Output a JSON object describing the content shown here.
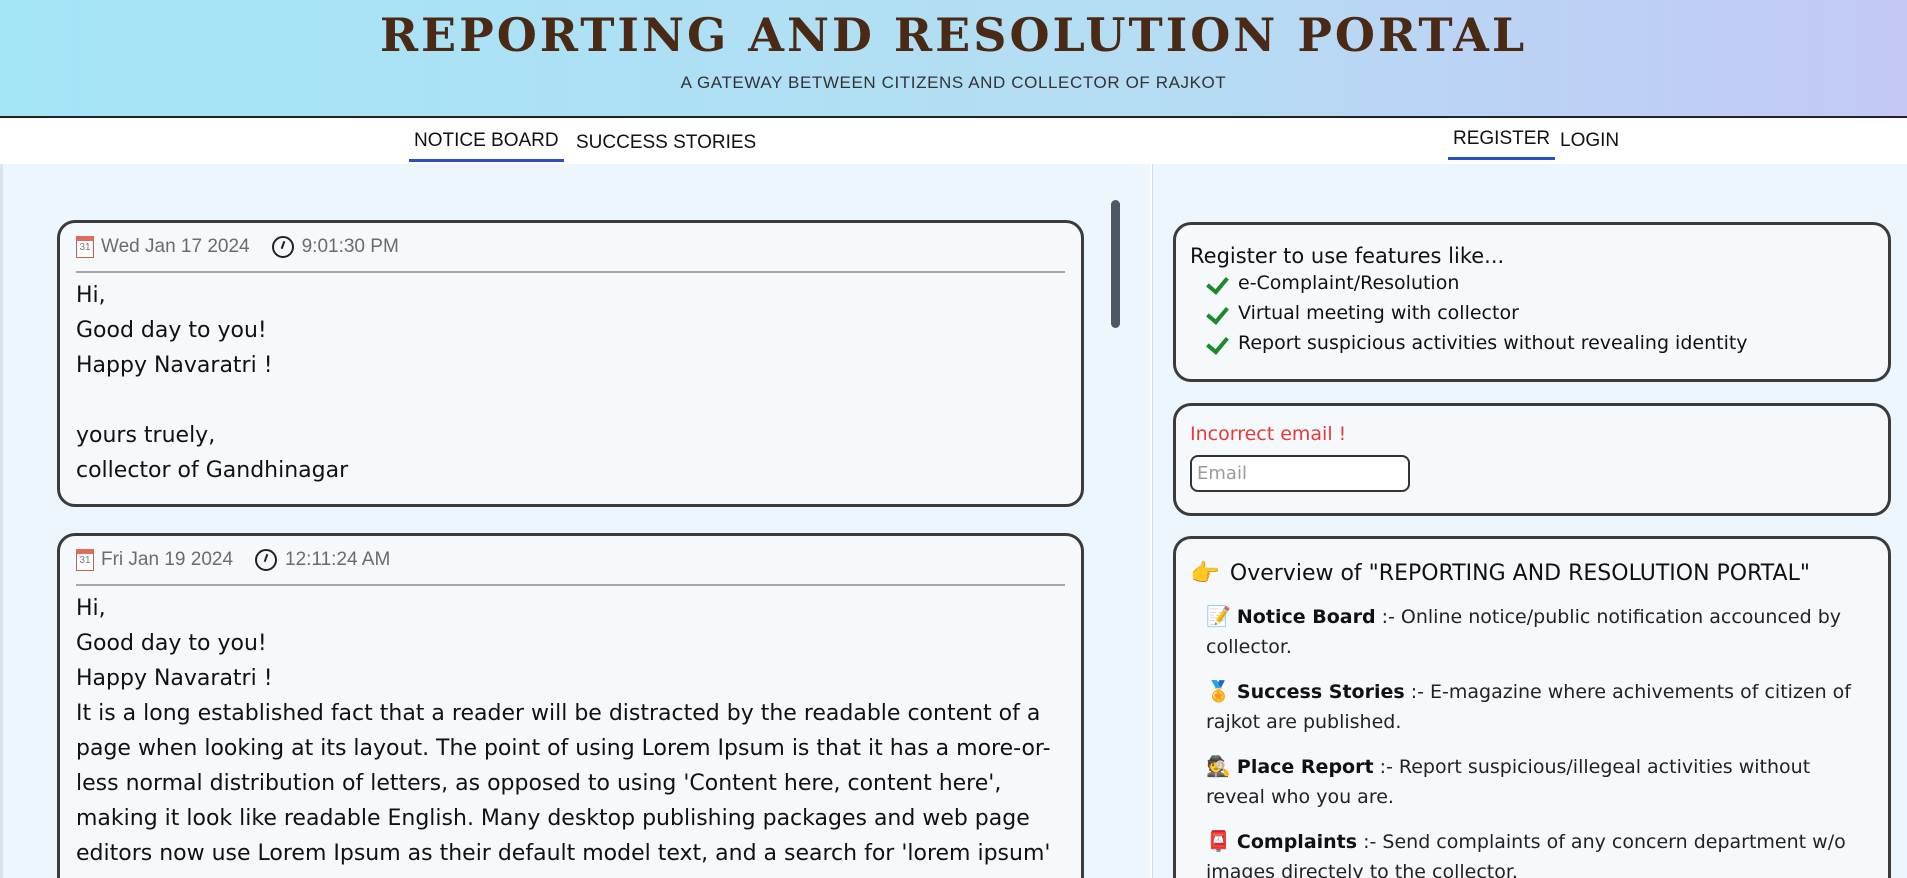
{
  "header": {
    "title": "REPORTING AND RESOLUTION PORTAL",
    "subtitle": "A GATEWAY BETWEEN CITIZENS AND COLLECTOR OF RAJKOT"
  },
  "nav": {
    "notice_board": "NOTICE BOARD",
    "success_stories": "SUCCESS STORIES",
    "register": "REGISTER",
    "login": "LOGIN"
  },
  "notices": [
    {
      "date": "Wed Jan 17 2024",
      "time": "9:01:30 PM",
      "body": "Hi,\nGood day to you!\nHappy Navaratri !\n\nyours truely,\ncollector of Gandhinagar"
    },
    {
      "date": "Fri Jan 19 2024",
      "time": "12:11:24 AM",
      "body": "Hi,\nGood day to you!\nHappy Navaratri !\nIt is a long established fact that a reader will be distracted by the readable content of a page when looking at its layout. The point of using Lorem Ipsum is that it has a more-or-less normal distribution of letters, as opposed to using 'Content here, content here', making it look like readable English. Many desktop publishing packages and web page editors now use Lorem Ipsum as their default model text, and a search for 'lorem ipsum' will uncover"
    }
  ],
  "calendar_icon_text": "31",
  "features": {
    "title": "Register to use features like...",
    "items": [
      "e-Complaint/Resolution",
      "Virtual meeting with collector",
      "Report suspicious activities without revealing identity"
    ]
  },
  "email_form": {
    "error": "Incorrect email !",
    "placeholder": "Email"
  },
  "overview": {
    "icon": "👉",
    "title": "Overview of \"REPORTING AND RESOLUTION PORTAL\"",
    "items": [
      {
        "icon": "📝",
        "name": "Notice Board",
        "desc": " :- Online notice/public notification accounced by collector."
      },
      {
        "icon": "🏅",
        "name": "Success Stories",
        "desc": " :- E-magazine where achivements of citizen of rajkot are published."
      },
      {
        "icon": "🕵",
        "name": "Place Report",
        "desc": " :- Report suspicious/illegeal activities without reveal who you are."
      },
      {
        "icon": "📮",
        "name": "Complaints",
        "desc": " :- Send complaints of any concern department w/o images directely to the collector."
      }
    ]
  },
  "colors": {
    "title_brown": "#4a2a14",
    "active_tab_underline": "#2a4fc4",
    "error_red": "#e33a3a",
    "check_green": "#1d8a2a",
    "pane_bg": "#eef6fd"
  }
}
